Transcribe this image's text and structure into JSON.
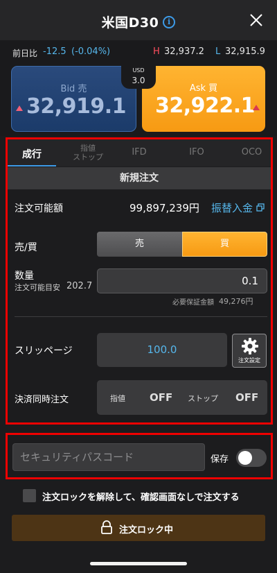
{
  "header": {
    "title": "米国D30"
  },
  "quote": {
    "change_label": "前日比",
    "change": "-12.5",
    "change_pct": "(-0.04%)",
    "high_label": "H",
    "high": "32,937.2",
    "low_label": "L",
    "low": "32,915.9"
  },
  "prices": {
    "bid_label": "Bid 売",
    "bid": "32,919.1",
    "ask_label": "Ask 買",
    "ask": "32,922.1",
    "spread_label": "USD",
    "spread": "3.0"
  },
  "tabs": [
    {
      "label": "成行",
      "active": true
    },
    {
      "label_line1": "指値",
      "label_line2": "ストップ"
    },
    {
      "label": "IFD"
    },
    {
      "label": "IFO"
    },
    {
      "label": "OCO"
    }
  ],
  "order": {
    "section_title": "新規注文",
    "available_label": "注文可能額",
    "available_value": "99,897,239円",
    "transfer_link": "振替入金",
    "side_label": "売/買",
    "sell_label": "売",
    "buy_label": "買",
    "selected_side": "buy",
    "quantity_label": "数量",
    "quantity_sub_label": "注文可能目安",
    "quantity_sub_value": "202.7",
    "quantity_value": "0.1",
    "margin_label": "必要保証金額",
    "margin_value": "49,276円",
    "slippage_label": "スリッページ",
    "slippage_value": "100.0",
    "settings_label": "注文設定",
    "settle_label": "決済同時注文",
    "settle_limit_label": "指値",
    "settle_limit_value": "OFF",
    "settle_stop_label": "ストップ",
    "settle_stop_value": "OFF"
  },
  "security": {
    "placeholder": "セキュリティパスコード",
    "save_label": "保存",
    "save_on": false
  },
  "confirm": {
    "text": "注文ロックを解除して、確認画面なしで注文する",
    "checked": false
  },
  "lock_button": {
    "label": "注文ロック中"
  },
  "colors": {
    "accent": "#3d9be8",
    "ask": "#f7a21b",
    "bid": "#1e3f70",
    "highlight": "#ef0000"
  }
}
